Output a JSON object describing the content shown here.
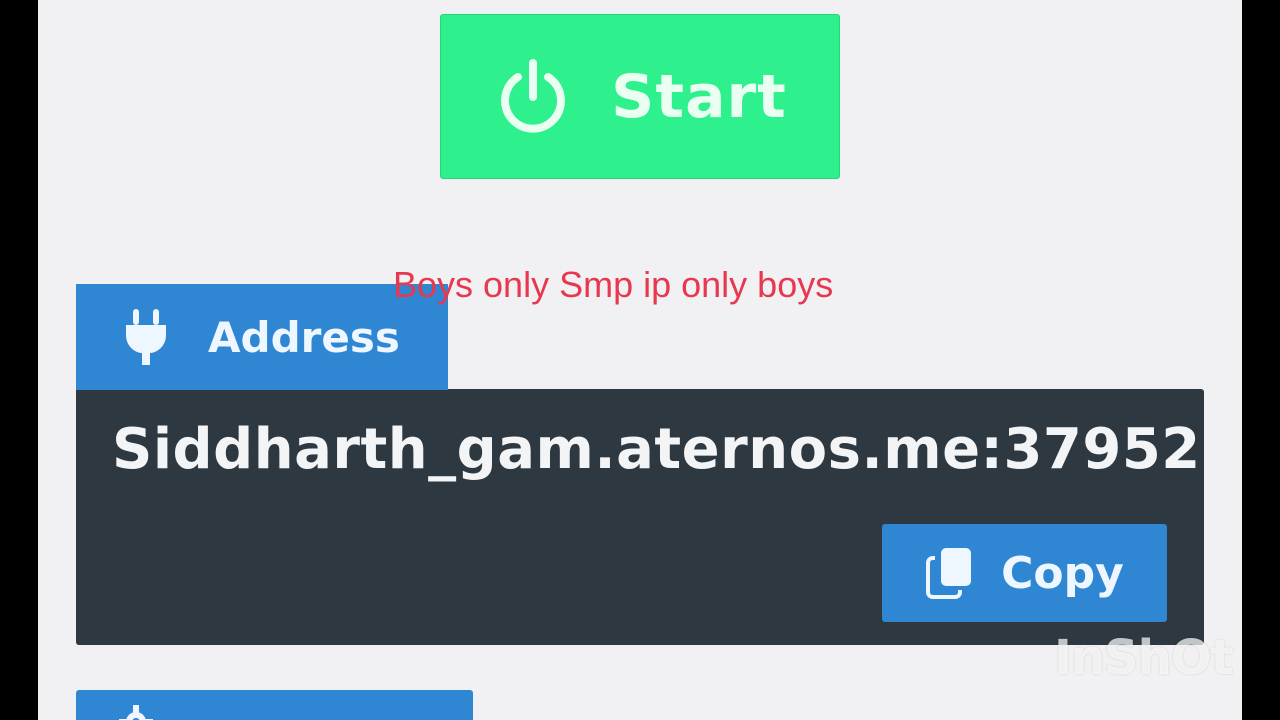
{
  "colors": {
    "start_green": "#2ef08c",
    "accent_blue": "#2f87d3",
    "panel_dark": "#2e3840",
    "page_background": "#f1f0f3",
    "caption_red": "#e8384f"
  },
  "start_button": {
    "label": "Start",
    "icon": "power-icon"
  },
  "overlay_caption": "Boys only Smp ip only boys",
  "address_section": {
    "tab_label": "Address",
    "tab_icon": "plug-icon",
    "value": "Siddharth_gam.aternos.me:37952",
    "copy_button": {
      "label": "Copy",
      "icon": "copy-icon"
    }
  },
  "next_section": {
    "tab_icon": "gear-icon"
  },
  "watermark": "InShOt"
}
